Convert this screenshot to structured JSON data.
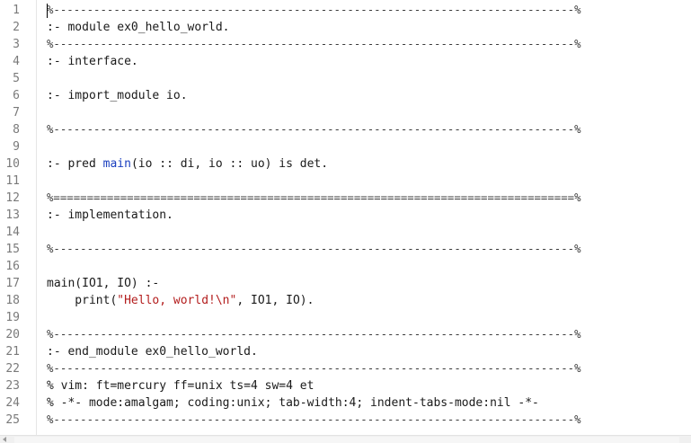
{
  "editor": {
    "lines": [
      {
        "number": "1",
        "segments": [
          {
            "t": "%------------------------------------------------------------------------------%",
            "c": "cm"
          }
        ]
      },
      {
        "number": "2",
        "segments": [
          {
            "t": ":- module ex0_hello_world.",
            "c": ""
          }
        ]
      },
      {
        "number": "3",
        "segments": [
          {
            "t": "%------------------------------------------------------------------------------%",
            "c": "cm"
          }
        ]
      },
      {
        "number": "4",
        "segments": [
          {
            "t": ":- interface.",
            "c": ""
          }
        ]
      },
      {
        "number": "5",
        "segments": []
      },
      {
        "number": "6",
        "segments": [
          {
            "t": ":- import_module io.",
            "c": ""
          }
        ]
      },
      {
        "number": "7",
        "segments": []
      },
      {
        "number": "8",
        "segments": [
          {
            "t": "%------------------------------------------------------------------------------%",
            "c": "cm"
          }
        ]
      },
      {
        "number": "9",
        "segments": []
      },
      {
        "number": "10",
        "segments": [
          {
            "t": ":- pred ",
            "c": ""
          },
          {
            "t": "main",
            "c": "kw-fn"
          },
          {
            "t": "(io :: di, io :: uo) is det.",
            "c": ""
          }
        ]
      },
      {
        "number": "11",
        "segments": []
      },
      {
        "number": "12",
        "segments": [
          {
            "t": "%==============================================================================%",
            "c": "cm-eq"
          }
        ]
      },
      {
        "number": "13",
        "segments": [
          {
            "t": ":- implementation.",
            "c": ""
          }
        ]
      },
      {
        "number": "14",
        "segments": []
      },
      {
        "number": "15",
        "segments": [
          {
            "t": "%------------------------------------------------------------------------------%",
            "c": "cm"
          }
        ]
      },
      {
        "number": "16",
        "segments": []
      },
      {
        "number": "17",
        "segments": [
          {
            "t": "main(IO1, IO) :-",
            "c": ""
          }
        ]
      },
      {
        "number": "18",
        "segments": [
          {
            "t": "    print(",
            "c": ""
          },
          {
            "t": "\"Hello, world!\\n\"",
            "c": "str"
          },
          {
            "t": ", IO1, IO).",
            "c": ""
          }
        ]
      },
      {
        "number": "19",
        "segments": []
      },
      {
        "number": "20",
        "segments": [
          {
            "t": "%------------------------------------------------------------------------------%",
            "c": "cm"
          }
        ]
      },
      {
        "number": "21",
        "segments": [
          {
            "t": ":- end_module ex0_hello_world.",
            "c": ""
          }
        ]
      },
      {
        "number": "22",
        "segments": [
          {
            "t": "%------------------------------------------------------------------------------%",
            "c": "cm"
          }
        ]
      },
      {
        "number": "23",
        "segments": [
          {
            "t": "% vim: ft=mercury ff=unix ts=4 sw=4 et",
            "c": ""
          }
        ]
      },
      {
        "number": "24",
        "segments": [
          {
            "t": "% -*- mode:amalgam; coding:unix; tab-width:4; indent-tabs-mode:nil -*-",
            "c": ""
          }
        ]
      },
      {
        "number": "25",
        "segments": [
          {
            "t": "%------------------------------------------------------------------------------%",
            "c": "cm"
          }
        ]
      }
    ]
  },
  "colors": {
    "function_name": "#1a3fbf",
    "string_literal": "#b31d1d",
    "line_number": "#7a7a7a"
  },
  "icons": {
    "scroll_left": "scroll-left-arrow-icon"
  }
}
